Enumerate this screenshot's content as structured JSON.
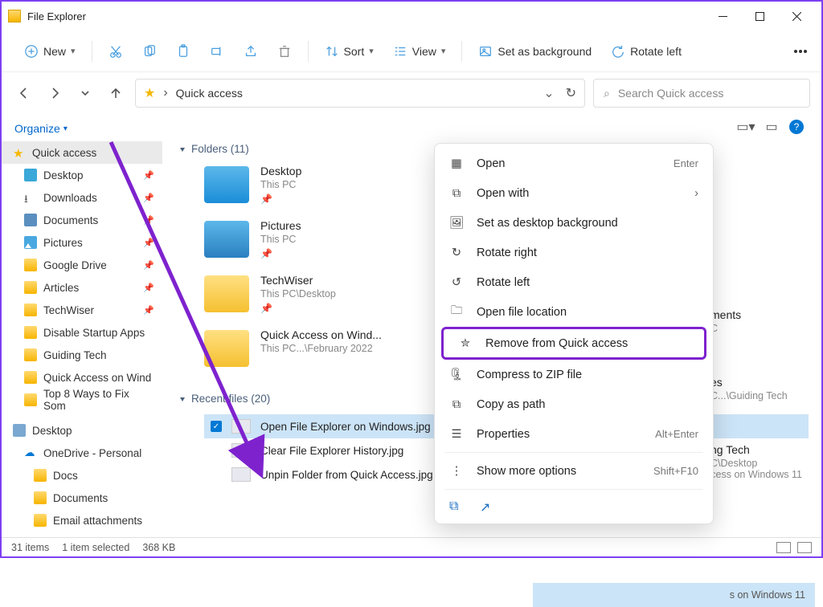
{
  "window": {
    "title": "File Explorer"
  },
  "toolbar": {
    "new": "New",
    "sort": "Sort",
    "view": "View",
    "set_bg": "Set as background",
    "rotate_left": "Rotate left"
  },
  "address": {
    "location": "Quick access"
  },
  "search": {
    "placeholder": "Search Quick access"
  },
  "organize": "Organize",
  "sidebar": {
    "quick_access": "Quick access",
    "items": [
      {
        "label": "Desktop",
        "pinned": true
      },
      {
        "label": "Downloads",
        "pinned": true
      },
      {
        "label": "Documents",
        "pinned": true
      },
      {
        "label": "Pictures",
        "pinned": true
      },
      {
        "label": "Google Drive",
        "pinned": true
      },
      {
        "label": "Articles",
        "pinned": true
      },
      {
        "label": "TechWiser",
        "pinned": true
      },
      {
        "label": "Disable Startup Apps",
        "pinned": false
      },
      {
        "label": "Guiding Tech",
        "pinned": false
      },
      {
        "label": "Quick Access on Wind",
        "pinned": false
      },
      {
        "label": "Top 8 Ways to Fix Som",
        "pinned": false
      }
    ],
    "desktop": "Desktop",
    "onedrive": "OneDrive - Personal",
    "od_items": [
      {
        "label": "Docs"
      },
      {
        "label": "Documents"
      },
      {
        "label": "Email attachments"
      }
    ]
  },
  "sections": {
    "folders": {
      "title": "Folders (11)"
    },
    "recent": {
      "title": "Recent files (20)"
    }
  },
  "folders": [
    {
      "name": "Desktop",
      "sub": "This PC",
      "icon": "bf-blue",
      "pinned": true
    },
    {
      "name": "Pictures",
      "sub": "This PC",
      "icon": "bf-pic",
      "pinned": true
    },
    {
      "name": "TechWiser",
      "sub": "This PC\\Desktop",
      "icon": "bf-yellow",
      "pinned": true
    },
    {
      "name": "Quick Access on Wind...",
      "sub": "This PC...\\February 2022",
      "icon": "bf-yellow",
      "pinned": false
    }
  ],
  "extras": [
    {
      "name": "ments",
      "sub": "C"
    },
    {
      "name": "es",
      "sub": "C...\\Guiding Tech"
    },
    {
      "name": "ng Tech",
      "sub": "C\\Desktop"
    }
  ],
  "recent_files": [
    {
      "name": "Open File Explorer on Windows.jpg",
      "selected": true,
      "path_tail": "s on Windows 11"
    },
    {
      "name": "Clear File Explorer History.jpg",
      "selected": false
    },
    {
      "name": "Unpin Folder from Quick Access.jpg",
      "selected": false,
      "path": "This PC\\Desktop\\Guidin...\\Quick Access on Windows 11"
    }
  ],
  "ctx": {
    "open": "Open",
    "open_sc": "Enter",
    "open_with": "Open with",
    "set_bg": "Set as desktop background",
    "rotate_right": "Rotate right",
    "rotate_left": "Rotate left",
    "open_loc": "Open file location",
    "remove": "Remove from Quick access",
    "zip": "Compress to ZIP file",
    "copy_path": "Copy as path",
    "props": "Properties",
    "props_sc": "Alt+Enter",
    "more": "Show more options",
    "more_sc": "Shift+F10"
  },
  "status": {
    "count": "31 items",
    "selected": "1 item selected",
    "size": "368 KB"
  }
}
